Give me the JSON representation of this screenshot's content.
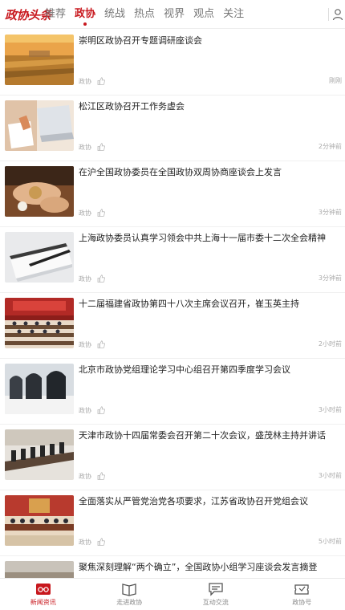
{
  "header": {
    "logo_text": "政协头条",
    "tabs": [
      {
        "label": "推荐",
        "active": false
      },
      {
        "label": "政协",
        "active": true
      },
      {
        "label": "统战",
        "active": false
      },
      {
        "label": "热点",
        "active": false
      },
      {
        "label": "视界",
        "active": false
      },
      {
        "label": "观点",
        "active": false
      },
      {
        "label": "关注",
        "active": false
      }
    ],
    "user_icon": "user-icon"
  },
  "colors": {
    "accent": "#c8181e",
    "meta": "#aaaaaa",
    "title": "#222222"
  },
  "articles": [
    {
      "title": "崇明区政协召开专题调研座谈会",
      "source": "政协",
      "time": "刚刚",
      "thumb": "sunset-fields-photo"
    },
    {
      "title": "松江区政协召开工作务虚会",
      "source": "政协",
      "time": "2分钟前",
      "thumb": "laptop-documents-photo"
    },
    {
      "title": "在沪全国政协委员在全国政协双周协商座谈会上发言",
      "source": "政协",
      "time": "3分钟前",
      "thumb": "hands-grain-photo"
    },
    {
      "title": "上海政协委员认真学习领会中共上海十一届市委十二次全会精神",
      "source": "政协",
      "time": "3分钟前",
      "thumb": "notebook-pen-photo"
    },
    {
      "title": "十二届福建省政协第四十八次主席会议召开，崔玉英主持",
      "source": "政协",
      "time": "2小时前",
      "thumb": "meeting-hall-photo"
    },
    {
      "title": "北京市政协党组理论学习中心组召开第四季度学习会议",
      "source": "政协",
      "time": "3小时前",
      "thumb": "empty-chairs-photo"
    },
    {
      "title": "天津市政协十四届常委会召开第二十次会议，盛茂林主持并讲话",
      "source": "政协",
      "time": "3小时前",
      "thumb": "conference-room-photo"
    },
    {
      "title": "全面落实从严管党治党各项要求，江苏省政协召开党组会议",
      "source": "政协",
      "time": "5小时前",
      "thumb": "red-meeting-room-photo"
    },
    {
      "title": "聚焦深刻理解“两个确立”，全国政协小组学习座谈会发言摘登",
      "source": "",
      "time": "",
      "thumb": "study-meeting-photo"
    }
  ],
  "bottom_nav": [
    {
      "label": "新闻资讯",
      "icon": "news-glasses-icon",
      "active": true
    },
    {
      "label": "走进政协",
      "icon": "book-icon",
      "active": false
    },
    {
      "label": "互动交流",
      "icon": "chat-icon",
      "active": false
    },
    {
      "label": "政协号",
      "icon": "ticket-icon",
      "active": false
    }
  ]
}
